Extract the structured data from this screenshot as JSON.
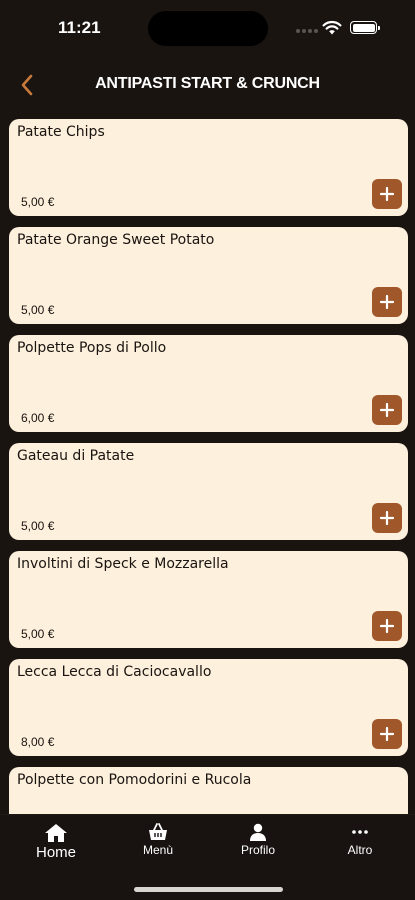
{
  "status": {
    "time": "11:21"
  },
  "header": {
    "title": "ANTIPASTI START & CRUNCH",
    "back_icon": "chevron-left-icon"
  },
  "colors": {
    "accent": "#a0582a",
    "card_bg": "#fdf0dc",
    "background": "#1a1411",
    "back_arrow": "#c77a3a"
  },
  "items": [
    {
      "name": "Patate Chips",
      "price": "5,00 €"
    },
    {
      "name": "Patate Orange Sweet Potato",
      "price": "5,00 €"
    },
    {
      "name": "Polpette Pops di Pollo",
      "price": "6,00 €"
    },
    {
      "name": "Gateau di Patate",
      "price": "5,00 €"
    },
    {
      "name": "Involtini di Speck e Mozzarella",
      "price": "5,00 €"
    },
    {
      "name": "Lecca Lecca di Caciocavallo",
      "price": "8,00 €"
    },
    {
      "name": "Polpette con Pomodorini e Rucola",
      "price": ""
    }
  ],
  "tabbar": {
    "home": {
      "label": "Home",
      "icon": "home-icon"
    },
    "menu": {
      "label": "Menù",
      "icon": "basket-icon"
    },
    "profile": {
      "label": "Profilo",
      "icon": "user-icon"
    },
    "more": {
      "label": "Altro",
      "icon": "more-dots-icon"
    }
  }
}
